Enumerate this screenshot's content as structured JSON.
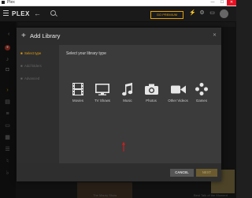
{
  "window": {
    "title": "Plex",
    "minimize": "—",
    "maximize": "☐",
    "close": "✕"
  },
  "topbar": {
    "logo": "PLEX",
    "back": "←",
    "promo": "GO PREMIUM"
  },
  "modal": {
    "title": "Add Library",
    "steps": [
      {
        "label": "Select type",
        "state": "active"
      },
      {
        "label": "Add folders",
        "state": "inactive"
      },
      {
        "label": "Advanced",
        "state": "inactive"
      }
    ],
    "prompt": "Select your library type",
    "types": [
      {
        "label": "Movies",
        "icon": "film-icon"
      },
      {
        "label": "TV Shows",
        "icon": "tv-icon"
      },
      {
        "label": "Music",
        "icon": "music-note-icon"
      },
      {
        "label": "Photos",
        "icon": "camera-icon"
      },
      {
        "label": "Other Videos",
        "icon": "video-camera-icon"
      },
      {
        "label": "Games",
        "icon": "gamepad-icon"
      }
    ],
    "buttons": {
      "cancel": "CANCEL",
      "next": "NEXT"
    }
  },
  "background": {
    "caption_left": "The Maury Show",
    "caption_right": "Best Talk of the Moment"
  },
  "colors": {
    "accent": "#e5a00d",
    "arrow": "#e0191b",
    "modal": "#3b3b3b"
  }
}
